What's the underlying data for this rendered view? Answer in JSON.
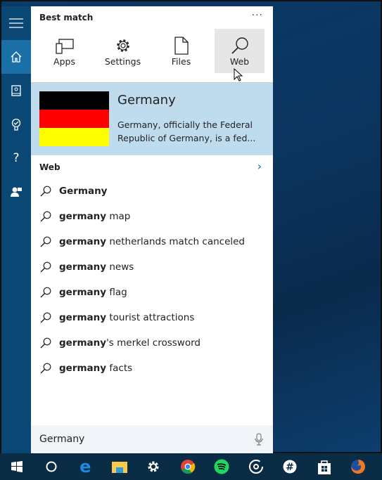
{
  "sidebar": {
    "items": [
      "menu-icon",
      "home-icon",
      "notebook-icon",
      "lightbulb-icon",
      "help-icon",
      "feedback-icon"
    ]
  },
  "panel": {
    "best_match": "Best match",
    "more": "···",
    "categories": [
      {
        "label": "Apps"
      },
      {
        "label": "Settings"
      },
      {
        "label": "Files"
      },
      {
        "label": "Web"
      }
    ],
    "result": {
      "title": "Germany",
      "description": "Germany, officially the Federal Republic of Germany, is a fed...",
      "flag_colors": [
        "#000000",
        "#ff0000",
        "#ffff00"
      ]
    },
    "web_header": "Web",
    "suggestions": [
      {
        "bold": "Germany",
        "rest": ""
      },
      {
        "bold": "germany",
        "rest": " map"
      },
      {
        "bold": "germany",
        "rest": " netherlands match canceled"
      },
      {
        "bold": "germany",
        "rest": " news"
      },
      {
        "bold": "germany",
        "rest": " flag"
      },
      {
        "bold": "germany",
        "rest": " tourist attractions"
      },
      {
        "bold": "germany",
        "rest": "'s merkel crossword"
      },
      {
        "bold": "germany",
        "rest": " facts"
      }
    ]
  },
  "search": {
    "value": "Germany"
  },
  "taskbar": {
    "items": [
      "windows-start-icon",
      "cortana-icon",
      "edge-icon",
      "file-explorer-icon",
      "settings-icon",
      "chrome-icon",
      "spotify-icon",
      "groove-icon",
      "slack-icon",
      "store-icon",
      "firefox-icon"
    ]
  },
  "colors": {
    "accent": "#1a70a6",
    "sidebar": "#0b4774",
    "result_bg": "#bfdcef",
    "taskbar": "#0b2c45"
  }
}
